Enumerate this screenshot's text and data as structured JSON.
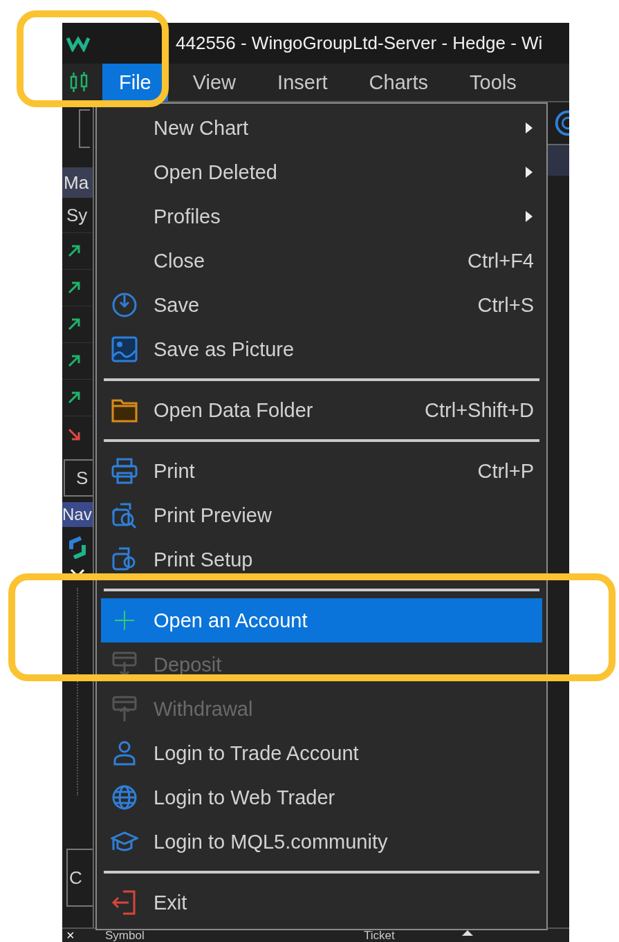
{
  "window": {
    "title": "442556 - WingoGroupLtd-Server - Hedge - Wi"
  },
  "menubar": [
    {
      "label": "File",
      "selected": true
    },
    {
      "label": "View",
      "selected": false
    },
    {
      "label": "Insert",
      "selected": false
    },
    {
      "label": "Charts",
      "selected": false
    },
    {
      "label": "Tools",
      "selected": false
    }
  ],
  "side_panel": {
    "market_tab": "Ma",
    "column_1": "Sy",
    "rows": [
      {
        "kind": "up"
      },
      {
        "kind": "up"
      },
      {
        "kind": "up"
      },
      {
        "kind": "up"
      },
      {
        "kind": "up"
      },
      {
        "kind": "down"
      }
    ],
    "tab_1": "S",
    "navigator_tab": "Nav",
    "tab_2": "C"
  },
  "file_menu": {
    "items": [
      {
        "kind": "item",
        "label": "New Chart",
        "submenu": true,
        "disabled": false,
        "selected": false
      },
      {
        "kind": "item",
        "label": "Open Deleted",
        "submenu": true,
        "disabled": false,
        "selected": false
      },
      {
        "kind": "item",
        "label": "Profiles",
        "submenu": true,
        "disabled": false,
        "selected": false
      },
      {
        "kind": "item",
        "label": "Close",
        "shortcut": "Ctrl+F4",
        "disabled": false,
        "selected": false
      },
      {
        "kind": "item",
        "label": "Save",
        "shortcut": "Ctrl+S",
        "disabled": false,
        "selected": false
      },
      {
        "kind": "item",
        "label": "Save as Picture",
        "disabled": false,
        "selected": false
      },
      {
        "kind": "separator"
      },
      {
        "kind": "item",
        "label": "Open Data Folder",
        "shortcut": "Ctrl+Shift+D",
        "disabled": false,
        "selected": false
      },
      {
        "kind": "separator"
      },
      {
        "kind": "item",
        "label": "Print",
        "shortcut": "Ctrl+P",
        "disabled": false,
        "selected": false
      },
      {
        "kind": "item",
        "label": "Print Preview",
        "disabled": false,
        "selected": false
      },
      {
        "kind": "item",
        "label": "Print Setup",
        "disabled": false,
        "selected": false
      },
      {
        "kind": "separator"
      },
      {
        "kind": "item",
        "label": "Open an Account",
        "disabled": false,
        "selected": true
      },
      {
        "kind": "item",
        "label": "Deposit",
        "disabled": true,
        "selected": false
      },
      {
        "kind": "item",
        "label": "Withdrawal",
        "disabled": true,
        "selected": false
      },
      {
        "kind": "item",
        "label": "Login to Trade Account",
        "disabled": false,
        "selected": false
      },
      {
        "kind": "item",
        "label": "Login to Web Trader",
        "disabled": false,
        "selected": false
      },
      {
        "kind": "item",
        "label": "Login to MQL5.community",
        "disabled": false,
        "selected": false
      },
      {
        "kind": "separator"
      },
      {
        "kind": "item",
        "label": "Exit",
        "disabled": false,
        "selected": false
      }
    ]
  },
  "toolbox": {
    "close": "×",
    "columns": [
      "Symbol",
      "Ticket"
    ]
  }
}
